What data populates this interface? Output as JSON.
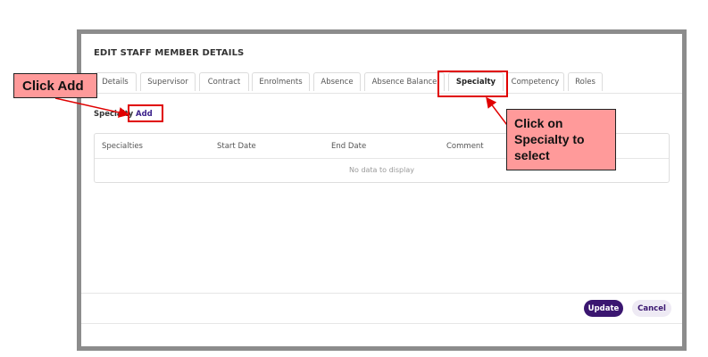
{
  "modal": {
    "title": "EDIT STAFF MEMBER DETAILS",
    "tabs": [
      {
        "label": "Details"
      },
      {
        "label": "Supervisor"
      },
      {
        "label": "Contract"
      },
      {
        "label": "Enrolments"
      },
      {
        "label": "Absence"
      },
      {
        "label": "Absence Balance"
      },
      {
        "label": "Specialty",
        "active": true
      },
      {
        "label": "Competency"
      },
      {
        "label": "Roles"
      }
    ],
    "section_label": "Specialty",
    "add_label": "Add",
    "table": {
      "columns": [
        "Specialties",
        "Start Date",
        "End Date",
        "Comment"
      ],
      "empty_text": "No data to display"
    },
    "buttons": {
      "update": "Update",
      "cancel": "Cancel"
    }
  },
  "annotations": {
    "click_add": "Click Add",
    "click_specialty_lines": [
      "Click on",
      "Specialty to",
      "select"
    ],
    "highlight_color": "#e00000",
    "callout_color": "#ff9a9a"
  },
  "colors": {
    "primary": "#3a1670",
    "link": "#3a1f8a"
  }
}
